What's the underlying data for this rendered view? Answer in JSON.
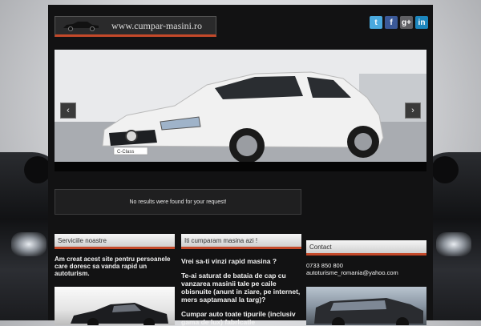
{
  "header": {
    "logo_text": "www.cumpar-masini.ro",
    "social": [
      {
        "icon": "twitter-icon",
        "glyph": "t"
      },
      {
        "icon": "facebook-icon",
        "glyph": "f"
      },
      {
        "icon": "google-plus-icon",
        "glyph": "g+"
      },
      {
        "icon": "linkedin-icon",
        "glyph": "in"
      }
    ]
  },
  "slider": {
    "prev_glyph": "‹",
    "next_glyph": "›",
    "plate_text": "C-Class"
  },
  "notice": {
    "text": "No results were found for your request!"
  },
  "columns": {
    "services": {
      "title": "Serviciile noastre",
      "text": "Am creat acest site pentru persoanele care doresc sa vanda rapid un autoturism."
    },
    "buy": {
      "title": "Iti cumparam masina azi !",
      "q1": "Vrei sa-ti vinzi rapid masina ?",
      "q2": "Te-ai saturat de bataia de cap cu vanzarea masinii tale pe caile obisnuite (anunt in ziare, pe internet, mers saptamanal la targ)?",
      "q3": "Cumpar auto toate tipurile (inclusiv gama de lux) fabricatie"
    },
    "contact": {
      "title": "Contact",
      "phone": "0733 850 800",
      "email": "autoturisme_romania@yahoo.com"
    }
  },
  "colors": {
    "accent": "#c4492a",
    "background": "#121213"
  }
}
